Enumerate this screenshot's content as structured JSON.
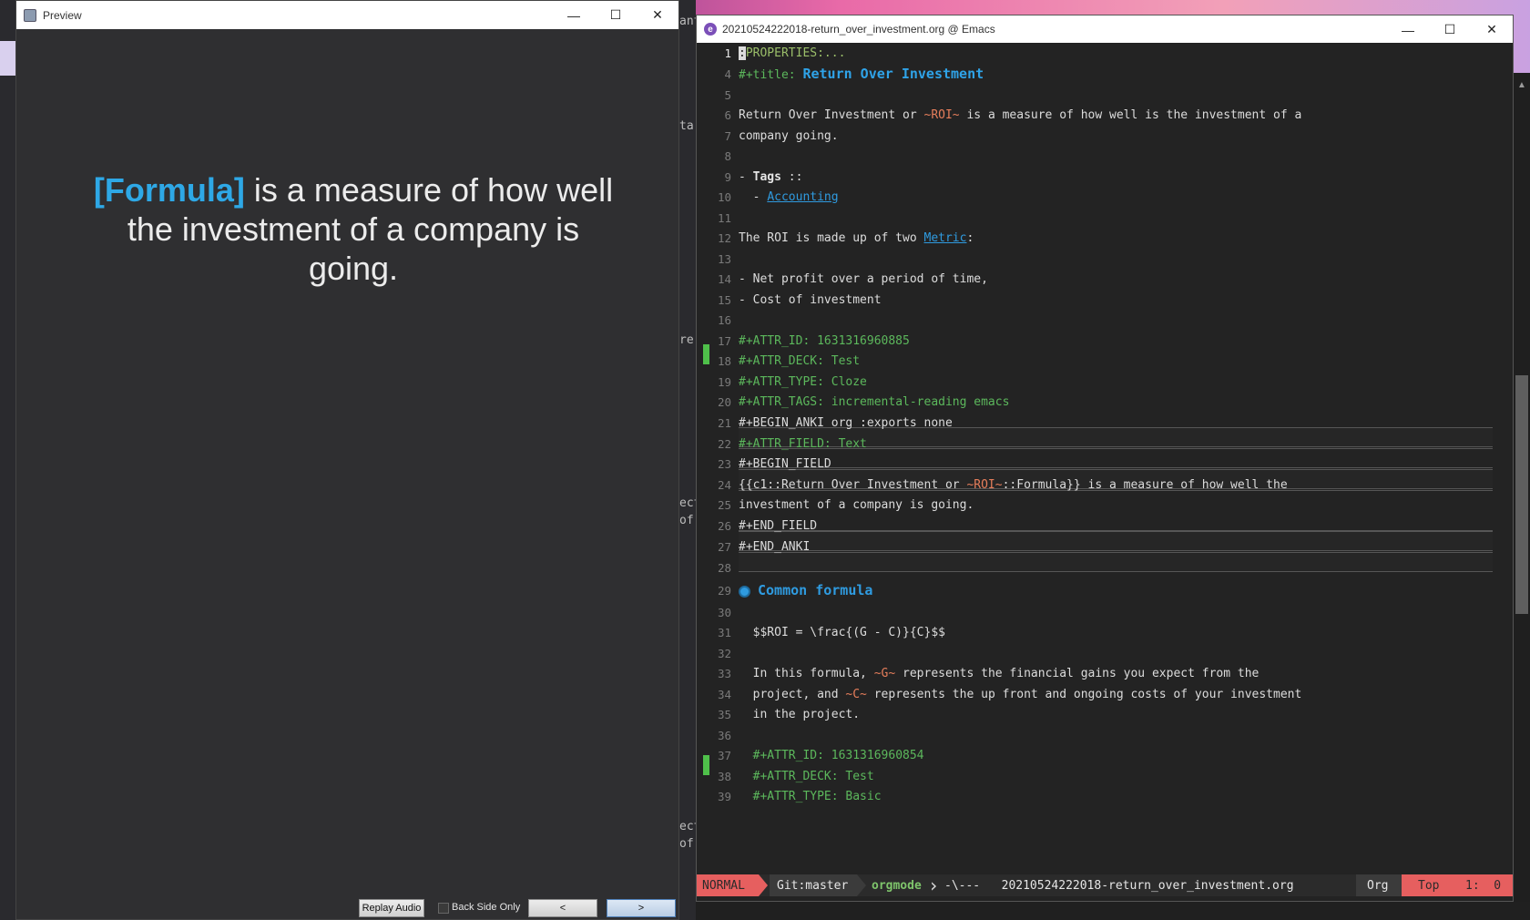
{
  "preview": {
    "title": "Preview",
    "card_cloze": "[Formula]",
    "card_rest": " is a measure of how well the investment of a company is going.",
    "replay_audio": "Replay Audio",
    "back_side_only": "Back Side Only",
    "prev_label": "<",
    "next_label": ">"
  },
  "emacs": {
    "title": "20210524222018-return_over_investment.org @ Emacs",
    "modeline": {
      "state": "NORMAL",
      "git": "Git:master",
      "major_mode": "orgmode",
      "separator": "-\\---",
      "filename": "20210524222018-return_over_investment.org",
      "mode_name": "Org",
      "position": "Top",
      "line_col": "1:  0"
    }
  },
  "background": {
    "middle_fragments": [
      "ant",
      "ta",
      "re",
      "ect",
      "of",
      "ect",
      "of"
    ]
  },
  "lines": {
    "l1_num": "1",
    "l1_cursor": ":",
    "l1_rest": "PROPERTIES:...",
    "l4_num": "4",
    "l4_kw": "#+title: ",
    "l4_title": "Return Over Investment",
    "l5_num": "5",
    "l6_num": "6",
    "l6_a": "Return Over Investment or ",
    "l6_code": "~ROI~",
    "l6_b": " is a measure of how well is the investment of a",
    "l7_num": "7",
    "l7_txt": "company going.",
    "l8_num": "8",
    "l9_num": "9",
    "l9_dash": "- ",
    "l9_bold": "Tags",
    "l9_rest": " ::",
    "l10_num": "10",
    "l10_dash": "  - ",
    "l10_link": "Accounting",
    "l11_num": "11",
    "l12_num": "12",
    "l12_a": "The ROI is made up of two ",
    "l12_link": "Metric",
    "l12_b": ":",
    "l13_num": "13",
    "l14_num": "14",
    "l14_txt": "- Net profit over a period of time,",
    "l15_num": "15",
    "l15_txt": "- Cost of investment",
    "l16_num": "16",
    "l17_num": "17",
    "l17_kw": "#+ATTR_ID: ",
    "l17_val": "1631316960885",
    "l18_num": "18",
    "l18_kw": "#+ATTR_DECK: ",
    "l18_val": "Test",
    "l19_num": "19",
    "l19_kw": "#+ATTR_TYPE: ",
    "l19_val": "Cloze",
    "l20_num": "20",
    "l20_kw": "#+ATTR_TAGS: ",
    "l20_val": "incremental-reading emacs",
    "l21_num": "21",
    "l21_txt": "#+BEGIN_ANKI org :exports none",
    "l22_num": "22",
    "l22_kw": "#+ATTR_FIELD: ",
    "l22_val": "Text",
    "l23_num": "23",
    "l23_txt": "#+BEGIN_FIELD",
    "l24_num": "24",
    "l24_a": "{{c1::Return Over Investment or ",
    "l24_code": "~ROI~",
    "l24_b": "::Formula}} is a measure of how well the",
    "l25_num": "25",
    "l25_txt": "investment of a company is going.",
    "l26_num": "26",
    "l26_txt": "#+END_FIELD",
    "l27_num": "27",
    "l27_txt": "#+END_ANKI",
    "l28_num": "28",
    "l29_num": "29",
    "l29_heading": "Common formula",
    "l30_num": "30",
    "l31_num": "31",
    "l31_txt": "  $$ROI = \\frac{(G - C)}{C}$$",
    "l32_num": "32",
    "l33_num": "33",
    "l33_a": "  In this formula, ",
    "l33_code": "~G~",
    "l33_b": " represents the financial gains you expect from the",
    "l34_num": "34",
    "l34_a": "  project, and ",
    "l34_code": "~C~",
    "l34_b": " represents the up front and ongoing costs of your investment",
    "l35_num": "35",
    "l35_txt": "  in the project.",
    "l36_num": "36",
    "l37_num": "37",
    "l37_kw": "  #+ATTR_ID: ",
    "l37_val": "1631316960854",
    "l38_num": "38",
    "l38_kw": "  #+ATTR_DECK: ",
    "l38_val": "Test",
    "l39_num": "39",
    "l39_kw": "  #+ATTR_TYPE: ",
    "l39_val": "Basic"
  },
  "colors": {
    "cloze": "#2ea8e6",
    "keyword": "#5cb85c",
    "inline_code": "#e67e5b",
    "link": "#2f9be0",
    "evil_state": "#e65f5f",
    "git_gutter": "#4fc04a"
  },
  "icons": [
    "anki-icon",
    "emacs-icon",
    "minimize-icon",
    "maximize-icon",
    "close-icon",
    "bullet-icon"
  ]
}
